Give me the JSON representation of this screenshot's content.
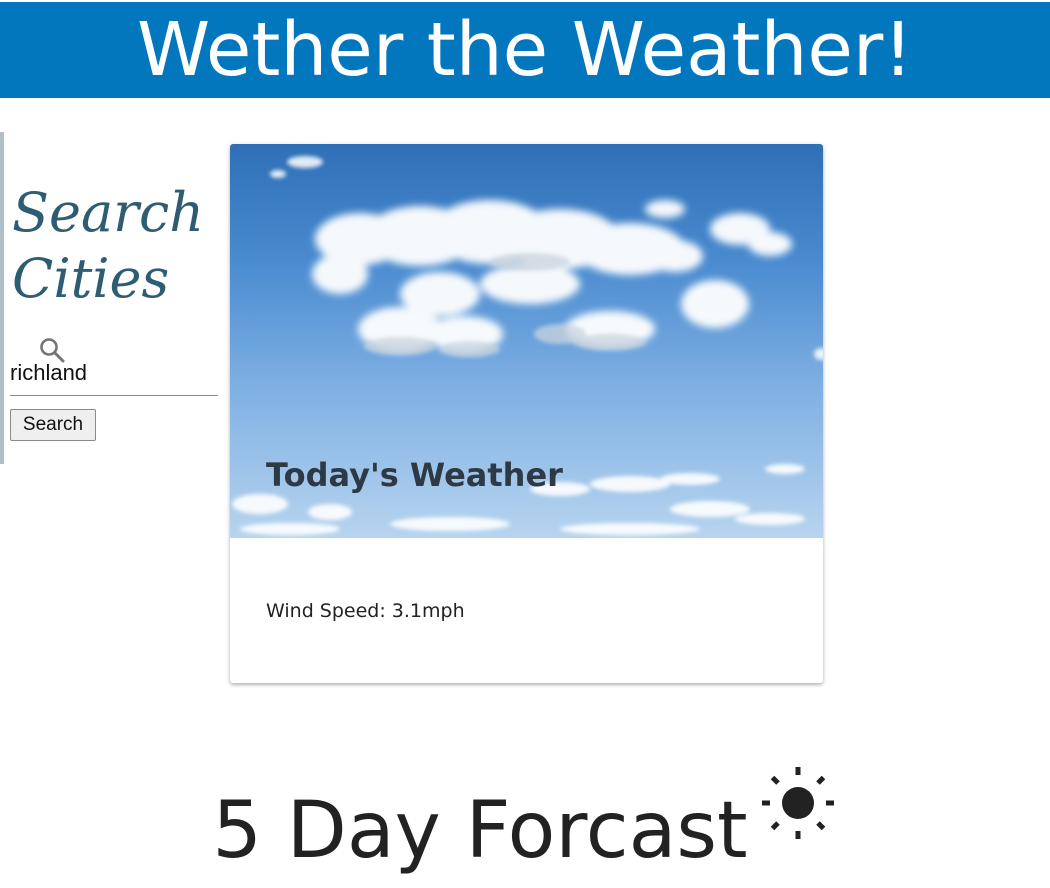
{
  "header": {
    "title": "Wether the Weather!",
    "background_color": "#0277bd"
  },
  "sidebar": {
    "title_line1": "Search",
    "title_line2": "Cities",
    "search_icon": "search-icon",
    "search_value": "richland",
    "search_button_label": "Search"
  },
  "weather_card": {
    "title": "Today's Weather",
    "wind_speed": "Wind Speed: 3.1mph",
    "image": "cloudy-sky-photo"
  },
  "forecast": {
    "title": "5 Day Forcast",
    "icon": "sun-icon"
  }
}
